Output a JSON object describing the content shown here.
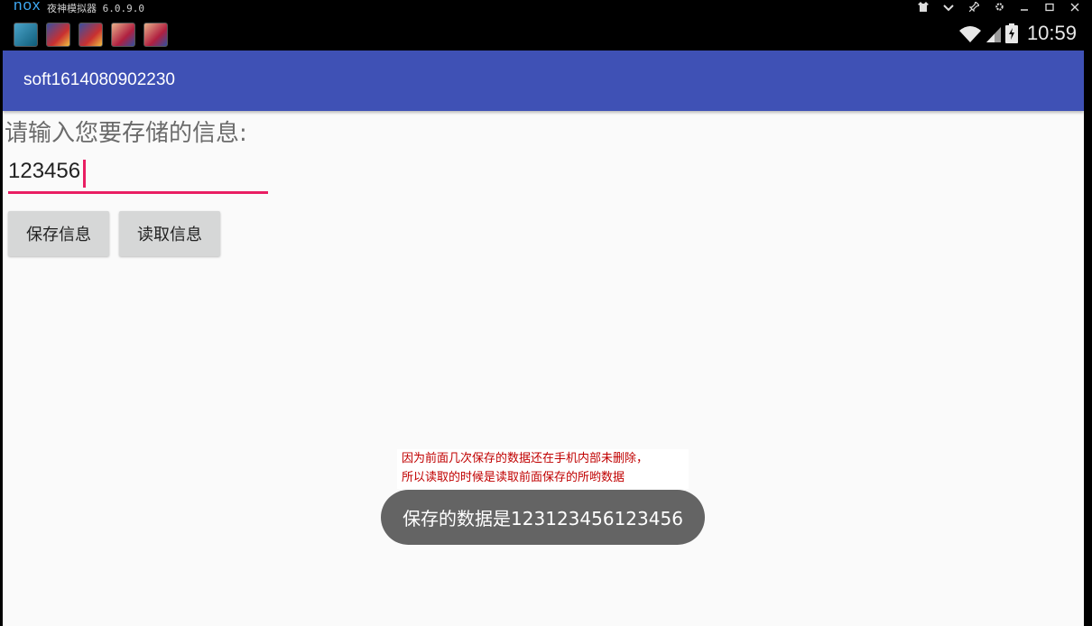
{
  "emulator": {
    "logo": "nox",
    "title": "夜神模拟器 6.0.9.0",
    "controls": [
      "shirt-icon",
      "chevron-down-icon",
      "pin-icon",
      "gear-icon",
      "minimize-icon",
      "maximize-icon",
      "close-icon"
    ]
  },
  "status_bar": {
    "notification_icons": [
      "nox-app-icon",
      "game-icon",
      "game-icon",
      "game-icon",
      "game-icon"
    ],
    "system_icons": [
      "wifi-icon",
      "signal-icon",
      "battery-icon"
    ],
    "time": "10:59"
  },
  "app": {
    "title": "soft1614080902230",
    "prompt": "请输入您要存储的信息:",
    "input_value": "123456",
    "save_button": "保存信息",
    "read_button": "读取信息",
    "accent_color": "#e91e63",
    "toolbar_color": "#3f51b5"
  },
  "annotation": {
    "line1": "因为前面几次保存的数据还在手机内部未删除，",
    "line2": "所以读取的时候是读取前面保存的所哟数据"
  },
  "toast": {
    "text": "保存的数据是123123456123456"
  }
}
